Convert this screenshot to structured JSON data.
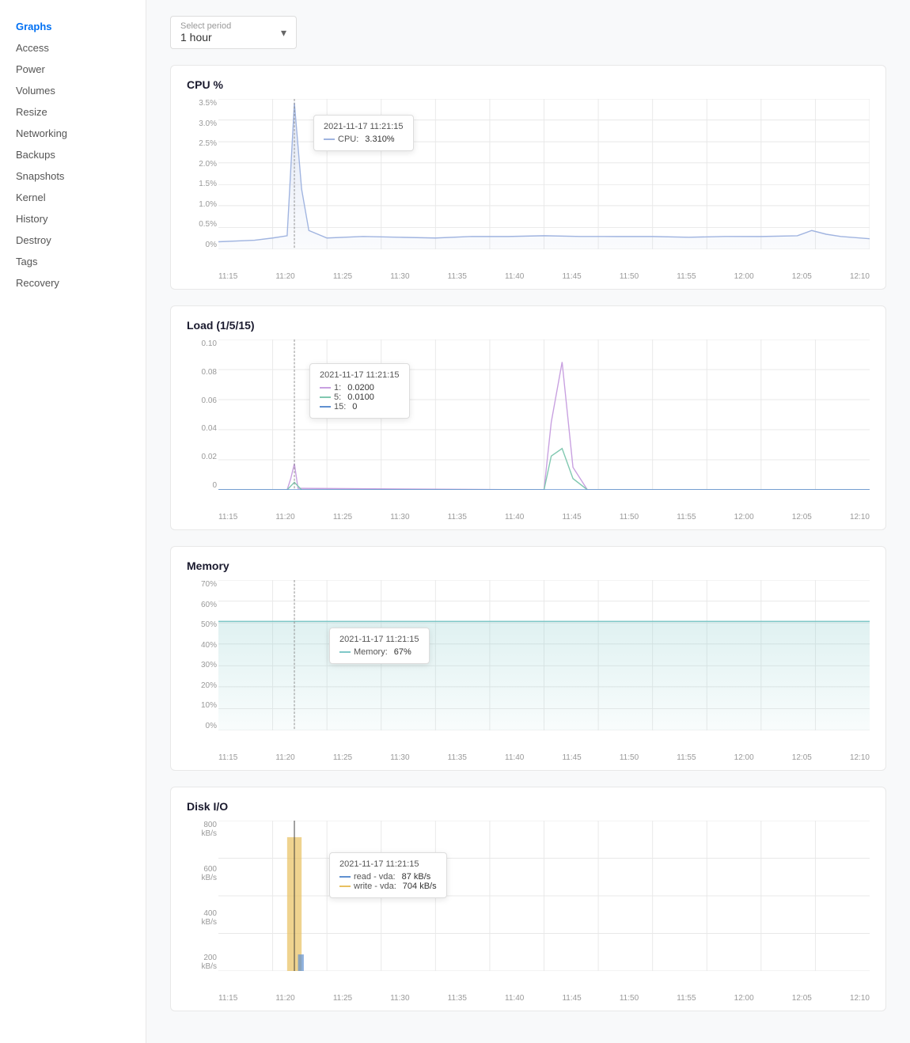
{
  "sidebar": {
    "items": [
      {
        "label": "Graphs",
        "active": true
      },
      {
        "label": "Access",
        "active": false
      },
      {
        "label": "Power",
        "active": false
      },
      {
        "label": "Volumes",
        "active": false
      },
      {
        "label": "Resize",
        "active": false
      },
      {
        "label": "Networking",
        "active": false
      },
      {
        "label": "Backups",
        "active": false
      },
      {
        "label": "Snapshots",
        "active": false
      },
      {
        "label": "Kernel",
        "active": false
      },
      {
        "label": "History",
        "active": false
      },
      {
        "label": "Destroy",
        "active": false
      },
      {
        "label": "Tags",
        "active": false
      },
      {
        "label": "Recovery",
        "active": false
      }
    ]
  },
  "period": {
    "label": "Select period",
    "value": "1 hour"
  },
  "charts": {
    "cpu": {
      "title": "CPU %",
      "tooltip": {
        "date": "2021-11-17 11:21:15",
        "rows": [
          {
            "color": "#a0b4e0",
            "label": "CPU:",
            "value": "3.310%"
          }
        ]
      },
      "yLabels": [
        "3.5%",
        "3.0%",
        "2.5%",
        "2.0%",
        "1.5%",
        "1.0%",
        "0.5%",
        "0%"
      ],
      "xLabels": [
        "11:15",
        "11:20",
        "11:25",
        "11:30",
        "11:35",
        "11:40",
        "11:45",
        "11:50",
        "11:55",
        "12:00",
        "12:05",
        "12:10"
      ]
    },
    "load": {
      "title": "Load (1/5/15)",
      "tooltip": {
        "date": "2021-11-17 11:21:15",
        "rows": [
          {
            "color": "#c8a0e0",
            "label": "1:",
            "value": "0.0200"
          },
          {
            "color": "#80c8b0",
            "label": "5:",
            "value": "0.0100"
          },
          {
            "color": "#6090d0",
            "label": "15:",
            "value": "0"
          }
        ]
      },
      "yLabels": [
        "0.10",
        "0.08",
        "0.06",
        "0.04",
        "0.02",
        "0"
      ],
      "xLabels": [
        "11:15",
        "11:20",
        "11:25",
        "11:30",
        "11:35",
        "11:40",
        "11:45",
        "11:50",
        "11:55",
        "12:00",
        "12:05",
        "12:10"
      ]
    },
    "memory": {
      "title": "Memory",
      "tooltip": {
        "date": "2021-11-17 11:21:15",
        "rows": [
          {
            "color": "#80c8c8",
            "label": "Memory:",
            "value": "67%"
          }
        ]
      },
      "yLabels": [
        "70%",
        "60%",
        "50%",
        "40%",
        "30%",
        "20%",
        "10%",
        "0%"
      ],
      "xLabels": [
        "11:15",
        "11:20",
        "11:25",
        "11:30",
        "11:35",
        "11:40",
        "11:45",
        "11:50",
        "11:55",
        "12:00",
        "12:05",
        "12:10"
      ]
    },
    "disk": {
      "title": "Disk I/O",
      "tooltip": {
        "date": "2021-11-17 11:21:15",
        "rows": [
          {
            "color": "#6090d0",
            "label": "read - vda:",
            "value": "87 kB/s"
          },
          {
            "color": "#e8c060",
            "label": "write - vda:",
            "value": "704 kB/s"
          }
        ]
      },
      "yLabels": [
        "800 kB/s",
        "600 kB/s",
        "400 kB/s",
        "200 kB/s"
      ],
      "xLabels": [
        "11:15",
        "11:20",
        "11:25",
        "11:30",
        "11:35",
        "11:40",
        "11:45",
        "11:50",
        "11:55",
        "12:00",
        "12:05",
        "12:10"
      ]
    }
  }
}
